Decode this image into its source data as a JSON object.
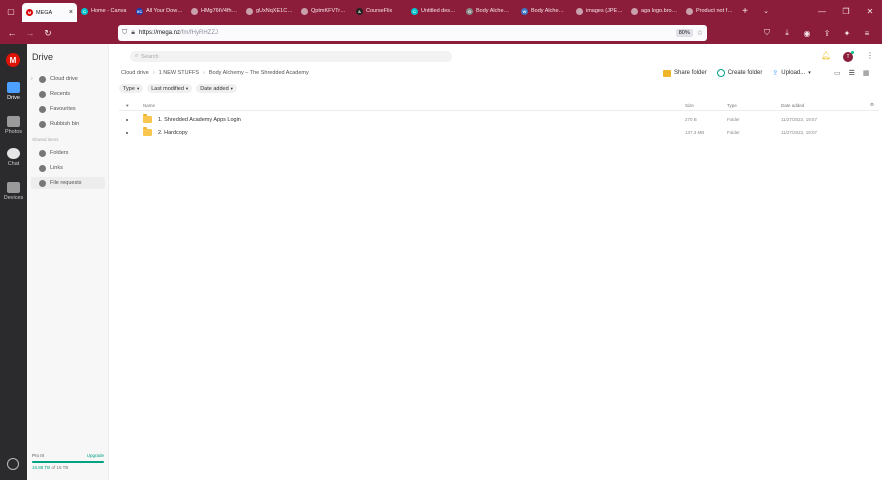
{
  "browser": {
    "tabs": [
      {
        "label": "MEGA",
        "active": true,
        "favicon_color": "#d90007",
        "favicon_text": "M"
      },
      {
        "label": "Home - Canva",
        "active": false,
        "favicon_color": "#00c4cc",
        "favicon_text": "C"
      },
      {
        "label": "All Your Dow…",
        "active": false,
        "favicon_color": "#1a3fb0",
        "favicon_text": "XC"
      },
      {
        "label": "HMg76tV4fhue ∙ ct…",
        "active": false,
        "favicon_color": "",
        "favicon_text": ""
      },
      {
        "label": "gUxNqXE1C ∙ c…",
        "active": false,
        "favicon_color": "",
        "favicon_text": ""
      },
      {
        "label": "QptmKFVTrN ∙ c…",
        "active": false,
        "favicon_color": "",
        "favicon_text": ""
      },
      {
        "label": "CourseFlix",
        "active": false,
        "favicon_color": "#222222",
        "favicon_text": "A"
      },
      {
        "label": "Untitled des…",
        "active": false,
        "favicon_color": "#00c4cc",
        "favicon_text": "C"
      },
      {
        "label": "Body Alchem…",
        "active": false,
        "favicon_color": "#888888",
        "favicon_text": "G"
      },
      {
        "label": "Body Alchem…",
        "active": false,
        "favicon_color": "#3a76c4",
        "favicon_text": "W"
      },
      {
        "label": "images (JPEG) ima…",
        "active": false,
        "favicon_color": "",
        "favicon_text": ""
      },
      {
        "label": "aga logo.bro…",
        "active": false,
        "favicon_color": "",
        "favicon_text": ""
      },
      {
        "label": "Product not found",
        "active": false,
        "favicon_color": "",
        "favicon_text": ""
      }
    ],
    "new_tab_glyph": "+",
    "address": {
      "host": "https://mega.nz",
      "path": "/fm/fHyRHZZJ",
      "zoom": "80%"
    }
  },
  "rail": {
    "logo": "M",
    "items": [
      {
        "label": "Drive",
        "active": true,
        "color": "#4da0ff"
      },
      {
        "label": "Photos",
        "active": false,
        "color": "#9a9a9a"
      },
      {
        "label": "Chat",
        "active": false,
        "color": "#e6e6e6"
      },
      {
        "label": "Devices",
        "active": false,
        "color": "#9a9a9a"
      }
    ]
  },
  "sidebar": {
    "title": "Drive",
    "items": [
      {
        "label": "Cloud drive",
        "caret": "›"
      },
      {
        "label": "Recents",
        "caret": ""
      },
      {
        "label": "Favourites",
        "caret": ""
      },
      {
        "label": "Rubbish bin",
        "caret": ""
      }
    ],
    "shared_section": "Shared items",
    "shared_items": [
      {
        "label": "Folders"
      },
      {
        "label": "Links"
      },
      {
        "label": "File requests"
      }
    ],
    "storage": {
      "plan": "Pro III",
      "upgrade": "Upgrade",
      "used": "16.88 TB",
      "total": "of 16 TB",
      "fraction": 1.0
    }
  },
  "main": {
    "search_placeholder": "Search",
    "breadcrumb": [
      "Cloud drive",
      "1 NEW STUFFS",
      "Body Alchemy – The Shredded Academy"
    ],
    "actions": {
      "share": "Share folder",
      "create": "Create folder",
      "upload": "Upload..."
    },
    "filters": [
      "Type",
      "Last modified",
      "Date added"
    ],
    "columns": {
      "name": "Name",
      "size": "Size",
      "type": "Type",
      "date": "Date added"
    },
    "rows": [
      {
        "name": "1. Shredded Academy Apps Login",
        "size": "270 B",
        "type": "Folder",
        "date": "11/27/2022, 19:57"
      },
      {
        "name": "2. Hardcopy",
        "size": "137.3 MB",
        "type": "Folder",
        "date": "11/27/2022, 19:07"
      }
    ],
    "avatar_initial": "T"
  },
  "colors": {
    "brand": "#8c1d3a",
    "mega_red": "#dd1405",
    "accent_green": "#00a382",
    "folder": "#f9c74f"
  }
}
